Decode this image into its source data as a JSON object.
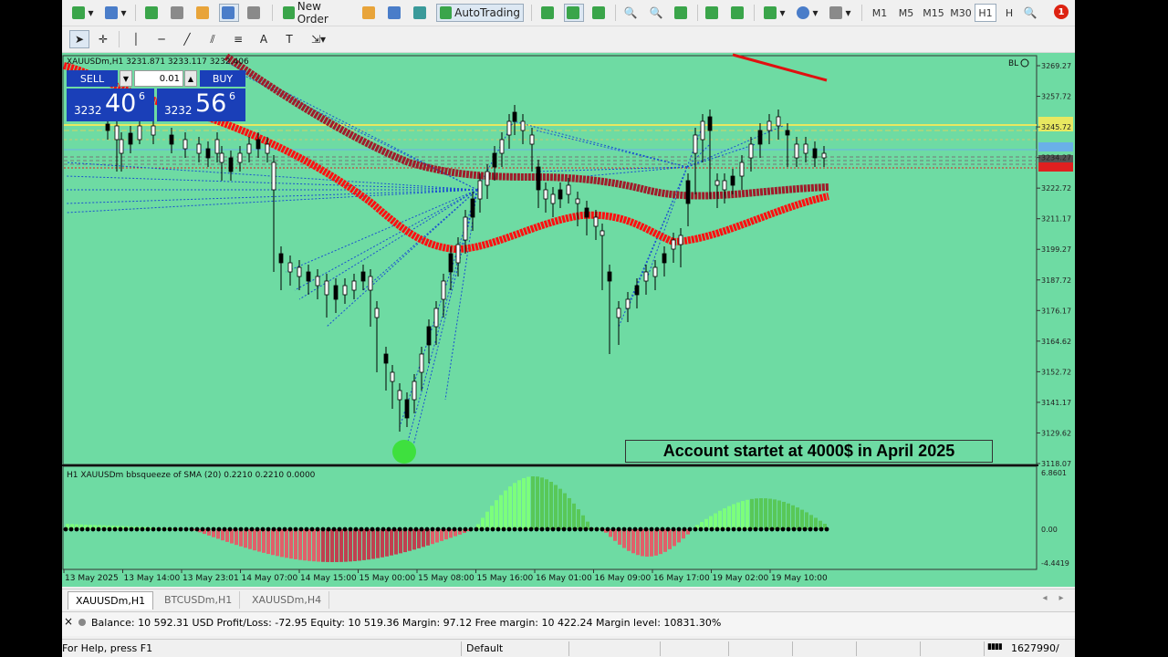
{
  "toolbar1": {
    "new_order": "New Order",
    "auto_trading": "AutoTrading",
    "timeframes": [
      "M1",
      "M5",
      "M15",
      "M30",
      "H1",
      "H"
    ],
    "active_timeframe": "H1",
    "notification_count": "1"
  },
  "chart": {
    "header": "XAUUSDm,H1  3231.871 3233.117 3232.406",
    "corner_label": "BL",
    "trade_panel": {
      "sell_label": "SELL",
      "buy_label": "BUY",
      "lot": "0.01",
      "sell_small": "3232",
      "sell_big": "40",
      "sell_sup": "6",
      "buy_small": "3232",
      "buy_big": "56",
      "buy_sup": "6"
    },
    "price_labels": [
      "3269.27",
      "3257.72",
      "3245.72",
      "3234.27",
      "3222.72",
      "3211.17",
      "3199.27",
      "3187.72",
      "3176.17",
      "3164.62",
      "3152.72",
      "3141.17",
      "3129.62",
      "3118.07"
    ],
    "indicator_header": "H1 XAUUSDm bbsqueeze of SMA (20) 0.2210 0.2210 0.0000",
    "indicator_labels": [
      "6.8601",
      "0.00",
      "-4.4419"
    ],
    "time_labels": [
      "13 May 2025",
      "13 May 14:00",
      "13 May 23:01",
      "14 May 07:00",
      "14 May 15:00",
      "15 May 00:00",
      "15 May 08:00",
      "15 May 16:00",
      "16 May 01:00",
      "16 May 09:00",
      "16 May 17:00",
      "19 May 02:00",
      "19 May 10:00"
    ],
    "annotation": "Account startet at 4000$ in April 2025",
    "colors": {
      "background": "#6edba3",
      "ma_red": "#ff0000",
      "ma_dark": "#a01c2a",
      "hist_green": "#7cff7c",
      "hist_red": "#e0505a"
    }
  },
  "tabs": [
    "XAUUSDm,H1",
    "BTCUSDm,H1",
    "XAUUSDm,H4"
  ],
  "terminal": {
    "balance_line": "Balance: 10 592.31 USD  Profit/Loss: -72.95  Equity: 10 519.36  Margin: 97.12  Free margin: 10 422.24  Margin level: 10831.30%"
  },
  "statusbar": {
    "help": "For Help, press F1",
    "profile": "Default",
    "traffic": "1627990/"
  }
}
